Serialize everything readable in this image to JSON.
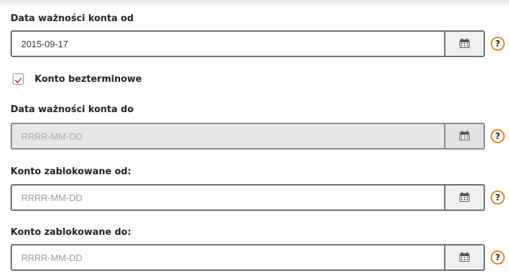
{
  "fields": {
    "valid_from": {
      "label": "Data ważności konta od",
      "value": "2015-09-17",
      "placeholder": "RRRR-MM-DD",
      "disabled": false
    },
    "unlimited": {
      "label": "Konto bezterminowe",
      "checked": true
    },
    "valid_to": {
      "label": "Data ważności konta do",
      "value": "",
      "placeholder": "RRRR-MM-DD",
      "disabled": true
    },
    "blocked_from": {
      "label": "Konto zablokowane od:",
      "value": "",
      "placeholder": "RRRR-MM-DD",
      "disabled": false
    },
    "blocked_to": {
      "label": "Konto zablokowane do:",
      "value": "",
      "placeholder": "RRRR-MM-DD",
      "disabled": false
    }
  },
  "help_icon": {
    "symbol": "?",
    "icon": "question-circle-icon",
    "color": "#e08a1e"
  },
  "calendar_icon": "calendar-icon",
  "checkbox_color": "#c8334a"
}
